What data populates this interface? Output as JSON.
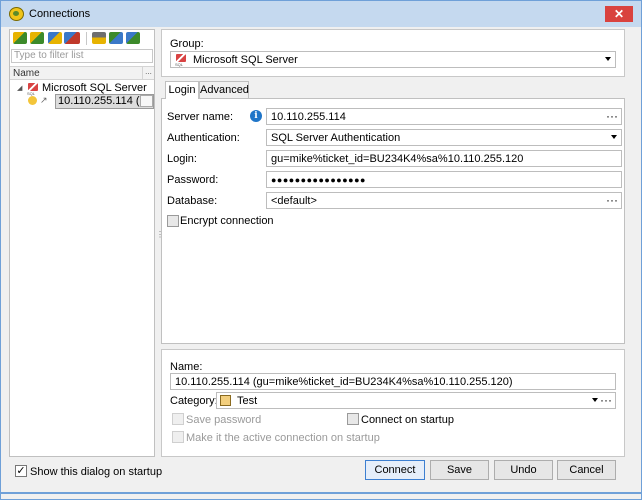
{
  "window": {
    "title": "Connections",
    "close_glyph": "✕"
  },
  "toolbar": {
    "icons": [
      "add-connection-icon",
      "add-group-icon",
      "connect-icon",
      "delete-icon",
      "properties-icon",
      "import-icon",
      "export-icon"
    ]
  },
  "left_panel": {
    "filter_placeholder": "Type to filter list",
    "column_header": "Name",
    "column_more": "...",
    "tree": {
      "group_label": "Microsoft SQL Server",
      "connection_label": "10.110.255.114 (..."
    }
  },
  "group_section": {
    "label": "Group:",
    "selected": "Microsoft SQL Server"
  },
  "tabs": [
    "Login",
    "Advanced"
  ],
  "login": {
    "server_name_label": "Server name:",
    "server_name_value": "10.110.255.114",
    "authentication_label": "Authentication:",
    "authentication_value": "SQL Server Authentication",
    "login_label": "Login:",
    "login_value": "gu=mike%ticket_id=BU234K4%sa%10.110.255.120",
    "password_label": "Password:",
    "password_value": "●●●●●●●●●●●●●●●●",
    "database_label": "Database:",
    "database_value": "<default>",
    "encrypt_label": "Encrypt connection",
    "more_glyph": "···"
  },
  "details": {
    "name_label": "Name:",
    "name_value": "10.110.255.114 (gu=mike%ticket_id=BU234K4%sa%10.110.255.120)",
    "category_label": "Category:",
    "category_value": "Test",
    "category_color": "#f3cf7e",
    "save_password_label": "Save password",
    "connect_on_startup_label": "Connect on startup",
    "active_connection_label": "Make it the active connection on startup"
  },
  "footer": {
    "show_dialog_label": "Show this dialog on startup",
    "connect_label": "Connect",
    "save_label": "Save",
    "undo_label": "Undo",
    "cancel_label": "Cancel"
  }
}
